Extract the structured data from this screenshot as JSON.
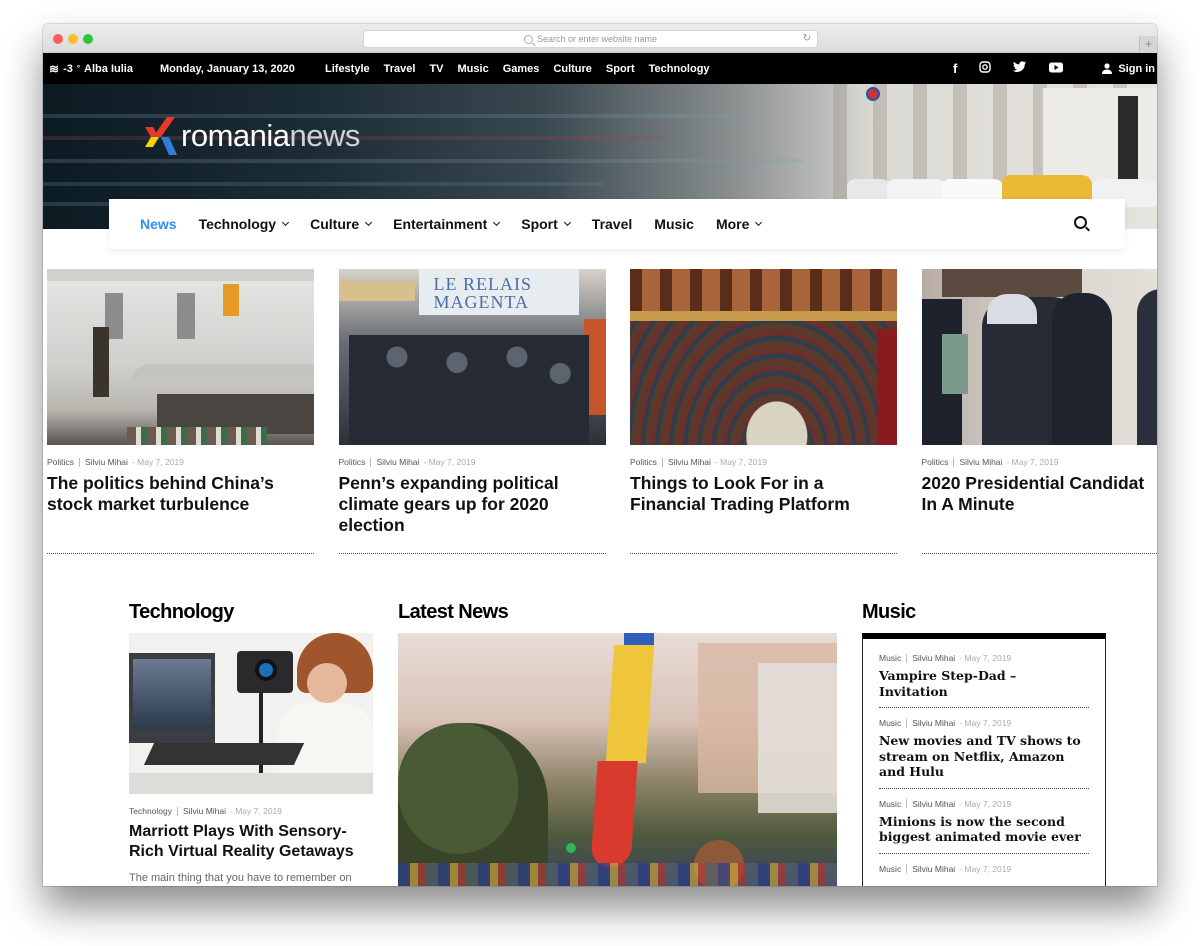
{
  "browser": {
    "url_placeholder": "Search or enter website name",
    "reload_icon": "reload-icon",
    "new_tab_label": "+"
  },
  "topbar": {
    "weather_icon": "fog-icon",
    "temperature": "-3",
    "temp_unit": "°",
    "city": "Alba Iulia",
    "date": "Monday, January 13, 2020",
    "nav": [
      "Lifestyle",
      "Travel",
      "TV",
      "Music",
      "Games",
      "Culture",
      "Sport",
      "Technology"
    ],
    "social": [
      "facebook-icon",
      "instagram-icon",
      "twitter-icon",
      "youtube-icon"
    ],
    "signin_label": "Sign in"
  },
  "logo": {
    "part1": "romania",
    "part2": "news"
  },
  "mainnav": {
    "items": [
      {
        "label": "News",
        "active": true,
        "dropdown": false
      },
      {
        "label": "Technology",
        "dropdown": true
      },
      {
        "label": "Culture",
        "dropdown": true
      },
      {
        "label": "Entertainment",
        "dropdown": true
      },
      {
        "label": "Sport",
        "dropdown": true
      },
      {
        "label": "Travel",
        "dropdown": false
      },
      {
        "label": "Music",
        "dropdown": false
      },
      {
        "label": "More",
        "dropdown": true
      }
    ],
    "accent_color": "#2e8ff0"
  },
  "featured": [
    {
      "category": "Politics",
      "author": "Silviu Mihai",
      "date": "May 7, 2019",
      "title_line1": "The politics behind China’s",
      "title_line2": "stock market turbulence",
      "title_line3": ""
    },
    {
      "category": "Politics",
      "author": "Silviu Mihai",
      "date": "May 7, 2019",
      "title_line1": "Penn’s expanding political",
      "title_line2": "climate gears up for 2020",
      "title_line3": "election"
    },
    {
      "category": "Politics",
      "author": "Silviu Mihai",
      "date": "May 7, 2019",
      "title_line1": "Things to Look For in a",
      "title_line2": "Financial Trading Platform",
      "title_line3": ""
    },
    {
      "category": "Politics",
      "author": "Silviu Mihai",
      "date": "May 7, 2019",
      "title_line1": "2020 Presidential Candidat",
      "title_line2": "In A Minute",
      "title_line3": ""
    }
  ],
  "sections": {
    "technology": {
      "heading": "Technology",
      "category": "Technology",
      "author": "Silviu Mihai",
      "date": "May 7, 2019",
      "title_line1": "Marriott Plays With Sensory-",
      "title_line2": "Rich Virtual Reality Getaways",
      "excerpt": "The main thing that you have to remember on"
    },
    "latest": {
      "heading": "Latest News"
    },
    "music": {
      "heading": "Music",
      "items": [
        {
          "category": "Music",
          "author": "Silviu Mihai",
          "date": "May 7, 2019",
          "title": "Vampire Step-Dad – Invitation"
        },
        {
          "category": "Music",
          "author": "Silviu Mihai",
          "date": "May 7, 2019",
          "title": "New movies and TV shows to stream on Netflix, Amazon and Hulu"
        },
        {
          "category": "Music",
          "author": "Silviu Mihai",
          "date": "May 7, 2019",
          "title": "Minions is now the second biggest animated movie ever"
        },
        {
          "category": "Music",
          "author": "Silviu Mihai",
          "date": "May 7, 2019",
          "title": ""
        }
      ]
    }
  }
}
